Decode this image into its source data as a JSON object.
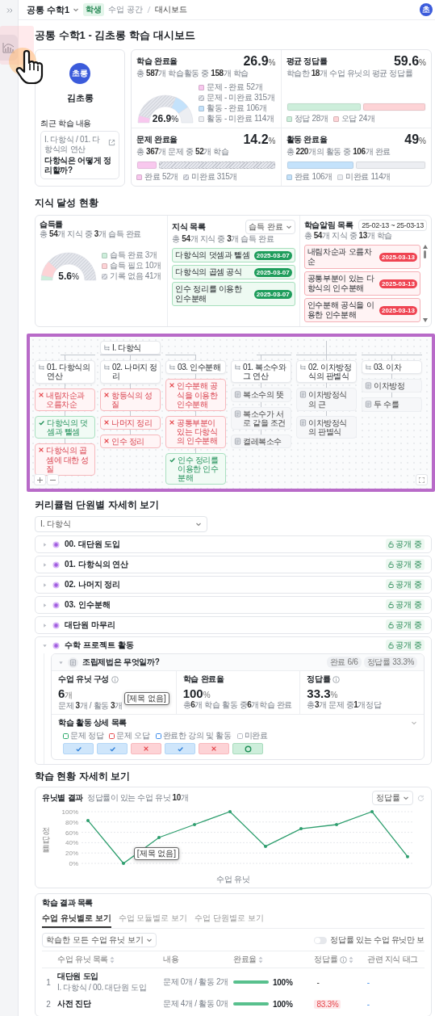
{
  "sidebar": {
    "items": [
      {
        "selected": true
      }
    ]
  },
  "topbar": {
    "course": "공통 수학1",
    "role": "학생",
    "breadcrumb": [
      {
        "label": "수업 공간",
        "current": false
      },
      {
        "label": "대시보드",
        "current": true
      }
    ],
    "avatar": "초"
  },
  "page_title": "공통 수학1 - 김초롱 학습 대시보드",
  "profile": {
    "avatar": "초롱",
    "name": "김초롱",
    "recent_label": "최근 학습 내용",
    "recent_path": "I. 다항식 / 01. 다항식의 연산",
    "recent_title": "다항식은 어떻게 정리할까?"
  },
  "stats": [
    {
      "kind": "gauge",
      "title": "학습 완료율",
      "subtitle": "총 **587**개 학습활동 중 **158**개 학습",
      "value": "26.9",
      "unit": "%",
      "center_value": "26.9",
      "center_unit": "%",
      "chart_data": {
        "type": "donut",
        "categories": [
          "문제 - 완료 52개",
          "문제 - 미완료 315개",
          "활동 - 완료 106개",
          "활동 - 미완료 114개"
        ],
        "values": [
          52,
          315,
          106,
          114
        ]
      },
      "legend": [
        {
          "color": "#f8c8ee",
          "hatched": false
        },
        {
          "color": "#e6e8ee",
          "hatched": true
        },
        {
          "color": "#c4e2fb",
          "hatched": false
        },
        {
          "color": "#eceef2",
          "hatched": false
        }
      ]
    },
    {
      "kind": "bars",
      "title": "평균 정답률",
      "subtitle": "학습한 **18**개 수업 유닛의 평균 정답률",
      "value": "59.6",
      "unit": "%",
      "segments": [
        {
          "label": "정답 28개",
          "color": "#cdeedb",
          "hatched": false,
          "level": 0.54
        },
        {
          "label": "오답 24개",
          "color": "#fdd3d6",
          "hatched": false,
          "level": 0.46
        }
      ]
    },
    {
      "kind": "bars",
      "title": "문제 완료율",
      "subtitle": "총 **367**개 문제 중 **52**개 학습",
      "value": "14.2",
      "unit": "%",
      "segments": [
        {
          "label": "완료 52개",
          "color": "#f8c8ee",
          "hatched": false,
          "level": 0.142
        },
        {
          "label": "미완료 315개",
          "color": "#e6e8ee",
          "hatched": true,
          "level": 0.858
        }
      ]
    },
    {
      "kind": "bars",
      "title": "활동 완료율",
      "subtitle": "총 **220**개의 활동 중 **106**개 완료",
      "value": "49",
      "unit": "%",
      "segments": [
        {
          "label": "완료 106개",
          "color": "#c4e2fb",
          "hatched": false,
          "level": 0.49
        },
        {
          "label": "미완료 114개",
          "color": "#eceef2",
          "hatched": false,
          "level": 0.51
        }
      ]
    }
  ],
  "knowledge": {
    "title": "지식 달성 현황",
    "mastery": {
      "title": "습득률",
      "subtitle": "총 **54**개 지식 중 **3**개 습득 완료",
      "center_value": "5.6",
      "center_unit": "%",
      "chart_data": {
        "type": "donut",
        "categories": [
          "습득 완료 3개",
          "습득 필요 10개",
          "기록 없음 41개"
        ],
        "values": [
          3,
          10,
          41
        ]
      },
      "legend": [
        {
          "color": "#cdeedb",
          "hatched": false
        },
        {
          "color": "#fdd3d6",
          "hatched": false
        },
        {
          "color": "#e6e8ee",
          "hatched": true
        }
      ]
    },
    "list": {
      "title": "지식 목록",
      "subtitle": "총 **54**개 지식 중 **3**개 습득 완료",
      "filter": "습득 완료",
      "items": [
        {
          "name": "다항식의 덧셈과 뺄셈",
          "date": "2025-03-07"
        },
        {
          "name": "다항식의 곱셈 공식",
          "date": "2025-03-07"
        },
        {
          "name": "인수 정리를 이용한 인수분해",
          "date": "2025-03-07"
        }
      ]
    },
    "alerts": {
      "title": "학습알림 목록",
      "subtitle": "총 **54**개 지식 중 **13**개 학습",
      "date_range": "25-02-13 ~ 25-03-13",
      "items": [
        {
          "name": "내림차순과 오름차순",
          "date": "2025-03-13"
        },
        {
          "name": "공통부분이 있는 다항식의 인수분해",
          "date": "2025-03-13"
        },
        {
          "name": "인수분해 공식을 이용한 인수분해",
          "date": "2025-03-13"
        }
      ]
    }
  },
  "knowledge_map": {
    "groups": [
      {
        "root": "I. 다항식",
        "units": [
          {
            "name": "01. 다항식의 연산",
            "nodes": [
              {
                "name": "내림차순과 오름차순",
                "kind": "needed"
              },
              {
                "name": "다항식의 덧셈과 뺄셈",
                "kind": "mastered"
              },
              {
                "name": "다항식의 곱셈에 대한 성질",
                "kind": "needed"
              }
            ]
          },
          {
            "name": "02. 나머지 정리",
            "nodes": [
              {
                "name": "항등식의 성질",
                "kind": "needed"
              },
              {
                "name": "나머지 정리",
                "kind": "needed"
              },
              {
                "name": "인수 정리",
                "kind": "needed"
              }
            ]
          },
          {
            "name": "03. 인수분해",
            "nodes": [
              {
                "name": "인수분해 공식을 이용한 인수분해",
                "kind": "needed"
              },
              {
                "name": "공통부분이 있는 다항식의 인수분해",
                "kind": "needed"
              },
              {
                "name": "인수 정리를 이용한 인수분해",
                "kind": "mastered"
              }
            ]
          }
        ]
      },
      {
        "units": [
          {
            "name": "01. 복소수와 그 연산",
            "nodes": [
              {
                "name": "복소수의 뜻",
                "kind": "unrecorded"
              },
              {
                "name": "복소수가 서로 같을 조건",
                "kind": "unrecorded"
              },
              {
                "name": "켤레복소수",
                "kind": "unrecorded"
              }
            ]
          },
          {
            "name": "02. 이차방정식의 판별식",
            "nodes": [
              {
                "name": "이차방정식의 근",
                "kind": "unrecorded"
              },
              {
                "name": "이차방정식의 판별식",
                "kind": "unrecorded"
              }
            ]
          },
          {
            "name": "03. 이차",
            "nodes": [
              {
                "name": "이차방정",
                "kind": "unrecorded"
              },
              {
                "name": "두 수를",
                "kind": "unrecorded"
              }
            ]
          }
        ]
      }
    ]
  },
  "curriculum": {
    "title": "커리큘럼 단원별 자세히 보기",
    "unit_select": "I. 다항식",
    "units": [
      {
        "name": "00. 대단원 도입",
        "status": "공개 중",
        "expanded": false
      },
      {
        "name": "01. 다항식의 연산",
        "status": "공개 중",
        "expanded": false
      },
      {
        "name": "02. 나머지 정리",
        "status": "공개 중",
        "expanded": false
      },
      {
        "name": "03. 인수분해",
        "status": "공개 중",
        "expanded": false
      },
      {
        "name": "대단원 마무리",
        "status": "공개 중",
        "expanded": false
      },
      {
        "name": "수학 프로젝트 활동",
        "status": "공개 중",
        "expanded": true,
        "lessons": [
          {
            "title": "조립제법은 무엇일까?",
            "expanded": true,
            "badges": [
              "완료 6/6",
              "정답률 33.3%"
            ],
            "metrics": [
              {
                "label": "수업 유닛 구성",
                "info": true,
                "value": "6",
                "unit": "개",
                "note": "문제 **3**개 / 활동 **3**개"
              },
              {
                "label": "학습 완료율",
                "info": false,
                "value": "100",
                "unit": "%",
                "note": "총**6**개 학습 활동 중**6**개학습 완료"
              },
              {
                "label": "정답률",
                "info": true,
                "value": "33.3",
                "unit": "%",
                "note": "총**3**개 문제 중**1**개정답"
              }
            ],
            "tooltip": "[제목 없음]",
            "detail_title": "학습 활동 상세 목록",
            "legend": [
              {
                "label": "문제 정답",
                "color": "#2aa86a"
              },
              {
                "label": "문제 오답",
                "color": "#e5484d"
              },
              {
                "label": "완료한 강의 및 활동",
                "color": "#3b8beb"
              },
              {
                "label": "미완료",
                "color": "#b8bcc4"
              }
            ],
            "activities": [
              {
                "kind": "activity"
              },
              {
                "kind": "activity"
              },
              {
                "kind": "wrong"
              },
              {
                "kind": "activity"
              },
              {
                "kind": "wrong"
              },
              {
                "kind": "correct"
              }
            ]
          }
        ]
      }
    ]
  },
  "learning": {
    "title": "학습 현황 자세히 보기",
    "unit_chart": {
      "title": "유닛별 결과",
      "subtitle": "정답률이 있는 수업 유닛 **10**개",
      "metric_select": "정답률",
      "tooltip": "[제목 없음]",
      "chart_data": {
        "type": "line",
        "xlabel": "수업 유닛",
        "ylabel": "정답률",
        "ylim": [
          0,
          100
        ],
        "yticks": [
          {
            "value": 0,
            "label": "0%"
          },
          {
            "value": 20,
            "label": "20%"
          },
          {
            "value": 40,
            "label": "40%"
          },
          {
            "value": 60,
            "label": "60%"
          },
          {
            "value": 80,
            "label": "80%"
          },
          {
            "value": 100,
            "label": "100%"
          }
        ],
        "grid": true,
        "series": [
          {
            "color": "#2e9e6e",
            "values": [
              83,
              0,
              50,
              75,
              100,
              33,
              67,
              75,
              100,
              13
            ]
          }
        ]
      }
    },
    "results": {
      "title": "학습 결과 목록",
      "tabs": [
        {
          "label": "수업 유닛별로 보기",
          "selected": true
        },
        {
          "label": "수업 모듈별로 보기",
          "selected": false
        },
        {
          "label": "수업 단원별로 보기",
          "selected": false
        }
      ],
      "filter": "학습한 모든 수업 유닛 보기",
      "toggle": {
        "label": "정답률 있는 수업 유닛만 보",
        "on": false
      },
      "columns": [
        {
          "label": "수업 유닛 목록",
          "sortable": true,
          "info": false
        },
        {
          "label": "내용",
          "sortable": false,
          "info": false
        },
        {
          "label": "완료율",
          "sortable": true,
          "info": false
        },
        {
          "label": "정답률",
          "sortable": true,
          "info": true
        },
        {
          "label": "관련 지식 태그",
          "sortable": false,
          "info": false
        }
      ],
      "rows": [
        {
          "index": "1",
          "name": "대단원 도입",
          "path": "I. 다항식 / 00. 대단원 도입",
          "content": "문제 0개 / 활동 2개",
          "level": 1,
          "completion": "100%",
          "accuracy": "-",
          "low": false,
          "tags": "-"
        },
        {
          "index": "2",
          "name": "사전 진단",
          "content": "문제 4개 / 활동 0개",
          "level": 1,
          "completion": "100%",
          "accuracy": "83.3%",
          "low": true,
          "tags": "-"
        }
      ]
    }
  }
}
